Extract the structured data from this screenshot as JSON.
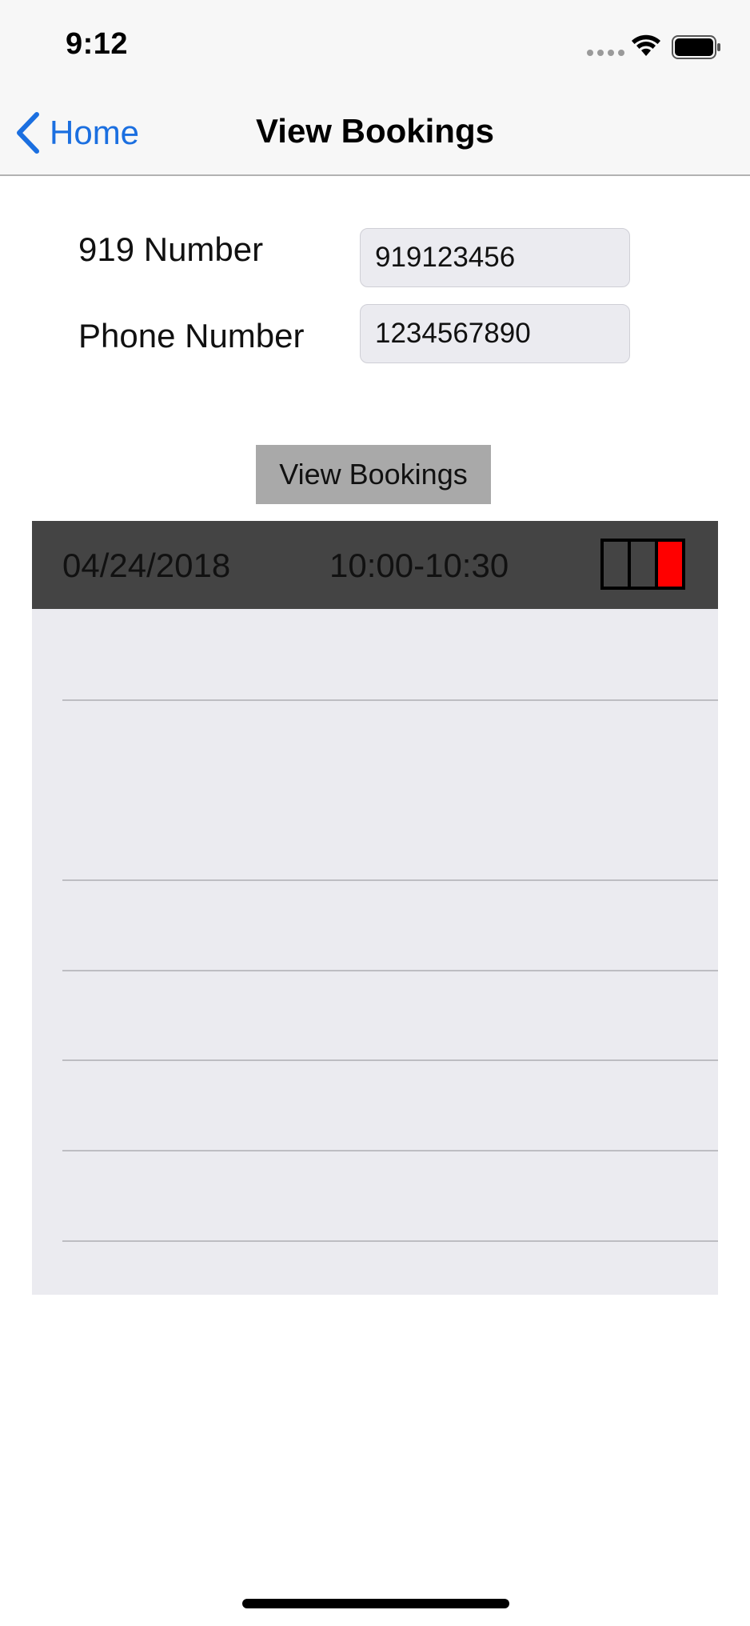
{
  "status_bar": {
    "time": "9:12"
  },
  "nav": {
    "back_label": "Home",
    "title": "View Bookings"
  },
  "form": {
    "number_919_label": "919 Number",
    "number_919_value": "919123456",
    "phone_label": "Phone Number",
    "phone_value": "1234567890",
    "submit_label": "View Bookings"
  },
  "bookings": {
    "rows": [
      {
        "date": "04/24/2018",
        "time": "10:00-10:30",
        "slots": [
          "empty",
          "empty",
          "filled"
        ]
      }
    ]
  },
  "colors": {
    "accent": "#1b6fe0",
    "selected_row": "#444444",
    "slot_filled": "#ff0000",
    "button": "#a9a9a9"
  }
}
